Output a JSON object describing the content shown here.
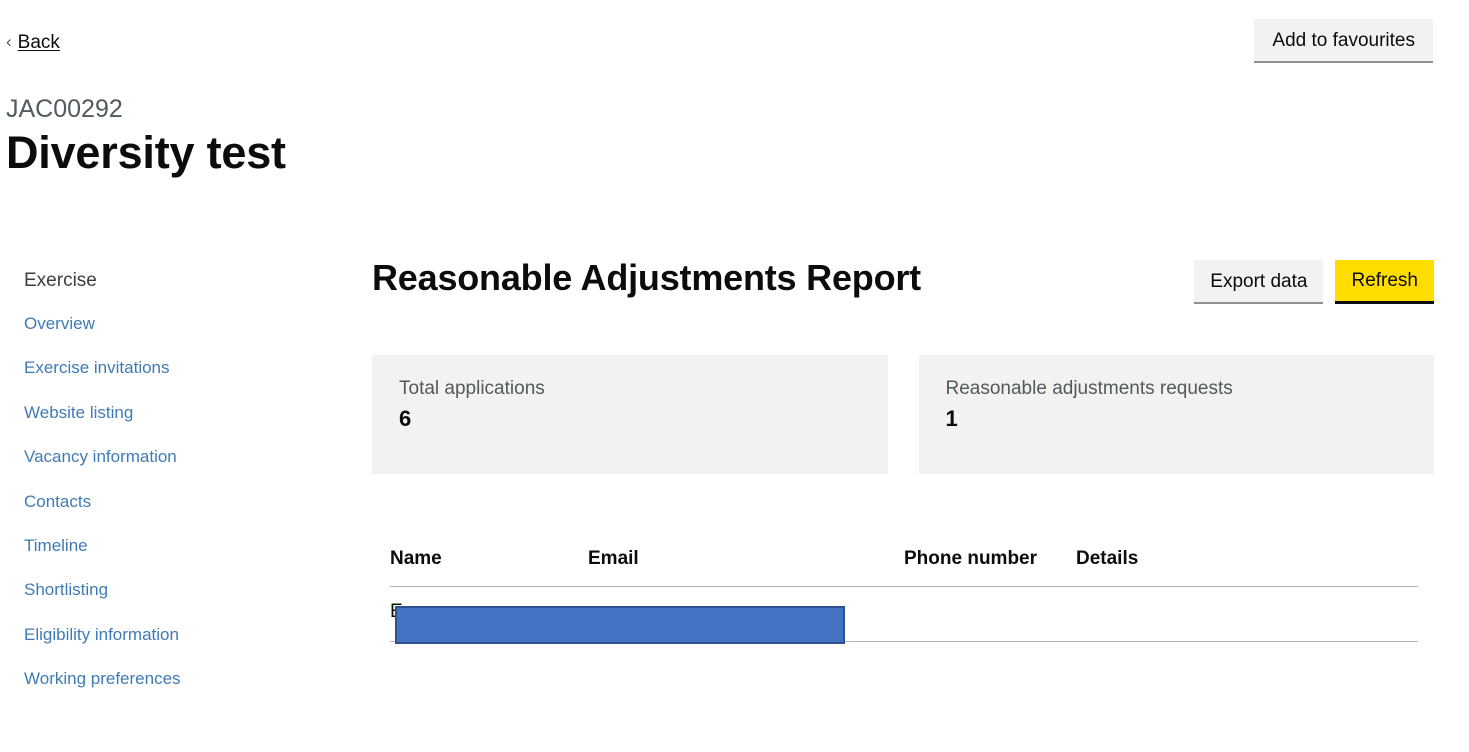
{
  "topbar": {
    "back_label": "Back",
    "back_chevron": "chevron-left-icon",
    "favourites_label": "Add to favourites"
  },
  "heading": {
    "reference": "JAC00292",
    "title": "Diversity test"
  },
  "sidebar": {
    "heading": "Exercise",
    "items": [
      {
        "label": "Overview"
      },
      {
        "label": "Exercise invitations"
      },
      {
        "label": "Website listing"
      },
      {
        "label": "Vacancy information"
      },
      {
        "label": "Contacts"
      },
      {
        "label": "Timeline"
      },
      {
        "label": "Shortlisting"
      },
      {
        "label": "Eligibility information"
      },
      {
        "label": "Working preferences"
      }
    ]
  },
  "content": {
    "report_title": "Reasonable Adjustments Report",
    "export_label": "Export data",
    "refresh_label": "Refresh",
    "cards": [
      {
        "label": "Total applications",
        "value": "6"
      },
      {
        "label": "Reasonable adjustments requests",
        "value": "1"
      }
    ],
    "table": {
      "columns": [
        "Name",
        "Email",
        "Phone number",
        "Details"
      ],
      "rows": [
        {
          "name": "E",
          "email": "",
          "phone": "",
          "details": ""
        }
      ]
    }
  },
  "annotation": {
    "type": "redaction-box",
    "fill": "#4472c4",
    "border": "#2f528f"
  },
  "colors": {
    "link": "#3f7bb5",
    "text": "#0b0c0c",
    "muted": "#505a5f",
    "card_bg": "#f3f2f1",
    "button_secondary_bg": "#f3f2f1",
    "button_warning_bg": "#ffdd00",
    "table_rule": "#b1b4b6"
  }
}
